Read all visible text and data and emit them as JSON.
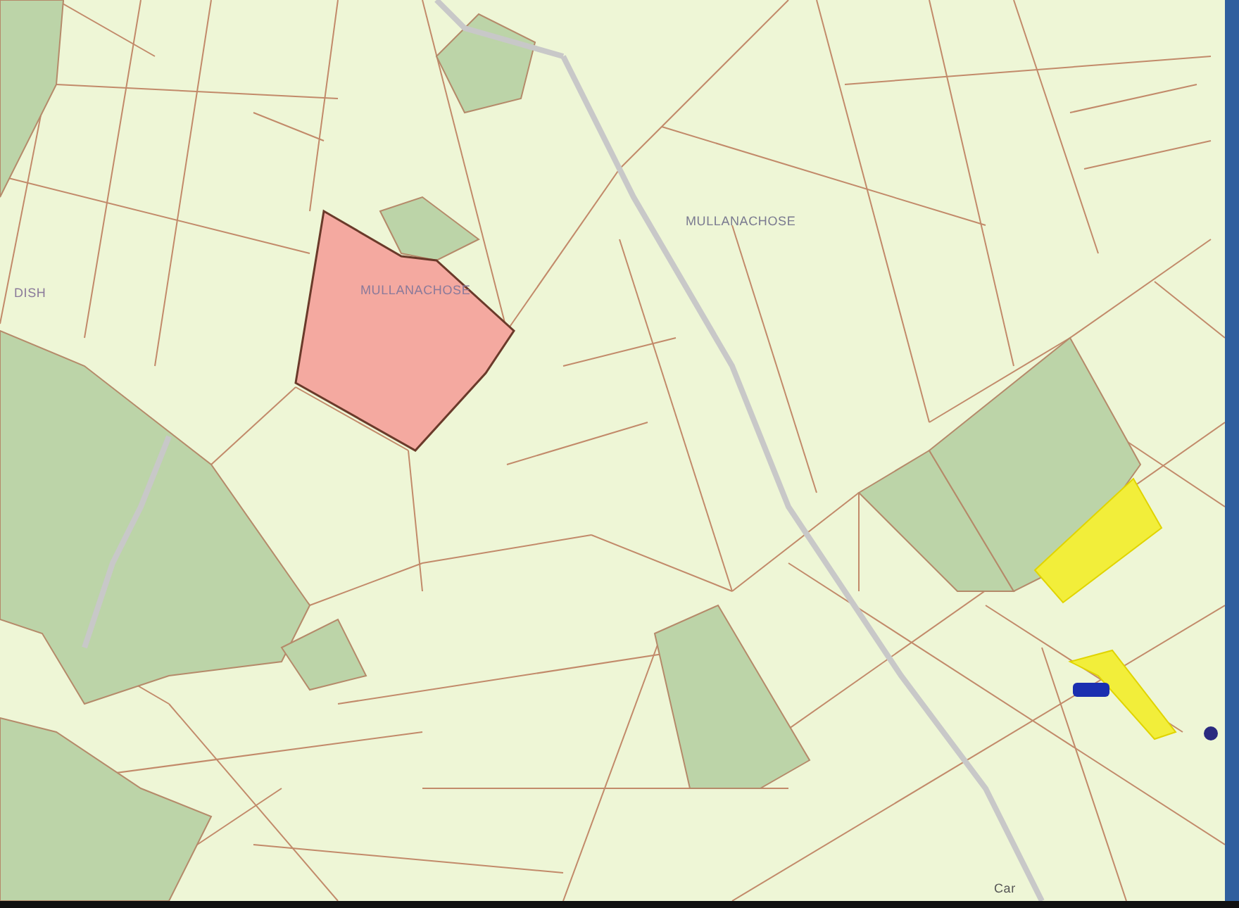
{
  "map": {
    "labels": [
      {
        "text": "DISH"
      },
      {
        "text": "MULLANACHOSE"
      },
      {
        "text": "MULLANACHOSE"
      },
      {
        "text": "Car"
      }
    ]
  }
}
